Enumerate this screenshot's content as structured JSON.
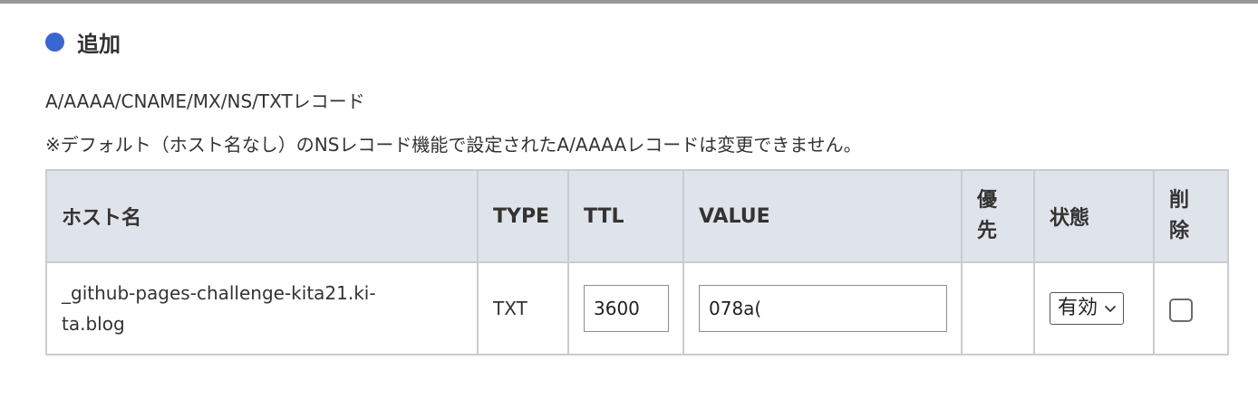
{
  "section": {
    "title": "追加",
    "accent_color": "#3a66d4",
    "icon": "blue-dot-icon"
  },
  "description": {
    "line1": "A/AAAA/CNAME/MX/NS/TXTレコード",
    "line2": "※デフォルト（ホスト名なし）のNSレコード機能で設定されたA/AAAAレコードは変更できません。"
  },
  "table": {
    "headers": {
      "host": "ホスト名",
      "type": "TYPE",
      "ttl": "TTL",
      "value": "VALUE",
      "priority_line1": "優",
      "priority_line2": "先",
      "status": "状態",
      "delete_line1": "削",
      "delete_line2": "除"
    },
    "rows": [
      {
        "host_line1": "_github-pages-challenge-kita21.ki-",
        "host_line2": "ta.blog",
        "type": "TXT",
        "ttl": "3600",
        "value": "078a(",
        "priority": "",
        "status": "有効",
        "delete_checked": false
      }
    ]
  }
}
